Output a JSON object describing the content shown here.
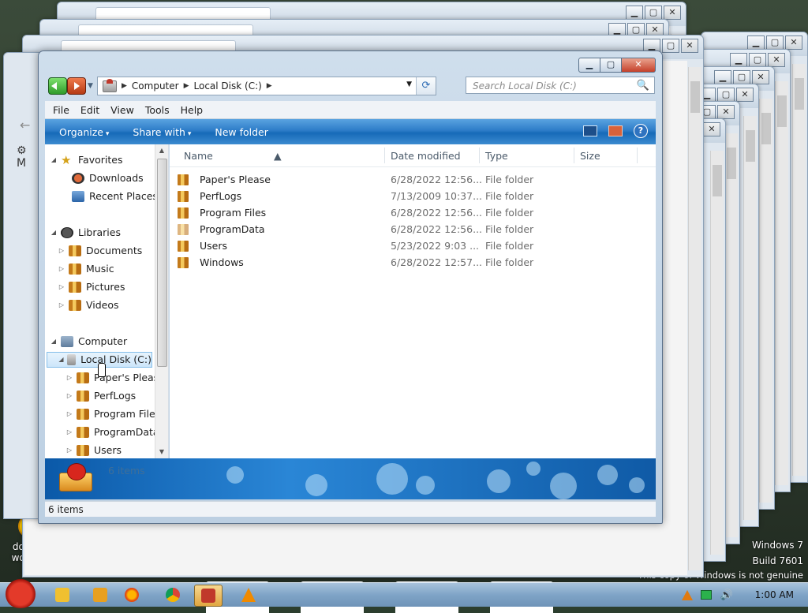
{
  "window": {
    "address": {
      "crumbs": [
        "Computer",
        "Local Disk (C:)"
      ]
    },
    "search_placeholder": "Search Local Disk (C:)",
    "menu": [
      "File",
      "Edit",
      "View",
      "Tools",
      "Help"
    ],
    "commands": {
      "organize": "Organize",
      "share_with": "Share with",
      "new_folder": "New folder"
    },
    "nav_tree": {
      "favorites": "Favorites",
      "favorites_items": [
        "Downloads",
        "Recent Places"
      ],
      "libraries": "Libraries",
      "library_items": [
        "Documents",
        "Music",
        "Pictures",
        "Videos"
      ],
      "computer": "Computer",
      "drive": "Local Disk (C:)",
      "drive_children": [
        "Paper's Please",
        "PerfLogs",
        "Program Files",
        "ProgramData",
        "Users"
      ]
    },
    "columns": {
      "name": "Name",
      "date_modified": "Date modified",
      "type": "Type",
      "size": "Size"
    },
    "files": [
      {
        "name": "Paper's Please",
        "date": "6/28/2022 12:56...",
        "type": "File folder"
      },
      {
        "name": "PerfLogs",
        "date": "7/13/2009 10:37...",
        "type": "File folder"
      },
      {
        "name": "Program Files",
        "date": "6/28/2022 12:56...",
        "type": "File folder"
      },
      {
        "name": "ProgramData",
        "date": "6/28/2022 12:56...",
        "type": "File folder"
      },
      {
        "name": "Users",
        "date": "5/23/2022 9:03 ...",
        "type": "File folder"
      },
      {
        "name": "Windows",
        "date": "6/28/2022 12:57...",
        "type": "File folder"
      }
    ],
    "details_count": "6 items",
    "status": "6 items"
  },
  "desktop": {
    "icon_label_line1": "doesn't",
    "icon_label_line2": "work lol",
    "icon2_label": "W",
    "watermark": [
      "Windows 7",
      "Build 7601",
      "This copy of Windows is not genuine"
    ]
  },
  "taskbar": {
    "clock": "1:00 AM"
  },
  "colors": {
    "accent": "#1f72c4",
    "close_red": "#c5402a",
    "folder": "#e8a82a"
  }
}
